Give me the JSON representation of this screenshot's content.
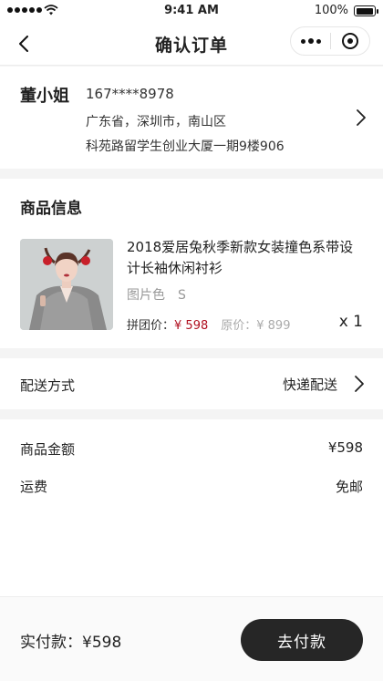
{
  "status_bar": {
    "time": "9:41 AM",
    "battery": "100%"
  },
  "nav": {
    "title": "确认订单"
  },
  "address": {
    "name": "董小姐",
    "phone": "167****8978",
    "region": "广东省，深圳市，南山区",
    "street": "科苑路留学生创业大厦一期9楼906"
  },
  "product": {
    "section_title": "商品信息",
    "title": "2018爱居兔秋季新款女装撞色系带设计长袖休闲衬衫",
    "spec": "图片色　S",
    "group_label": "拼团价：",
    "group_price": "¥ 598",
    "orig_label": "原价：",
    "orig_price": "¥ 899",
    "qty": "x 1"
  },
  "delivery": {
    "label": "配送方式",
    "value": "快递配送"
  },
  "summary": {
    "amount_label": "商品金额",
    "amount_value": "¥598",
    "shipping_label": "运费",
    "shipping_value": "免邮"
  },
  "footer": {
    "total": "实付款：¥598",
    "pay_label": "去付款"
  },
  "colors": {
    "accent": "#b01020",
    "button": "#262626"
  }
}
